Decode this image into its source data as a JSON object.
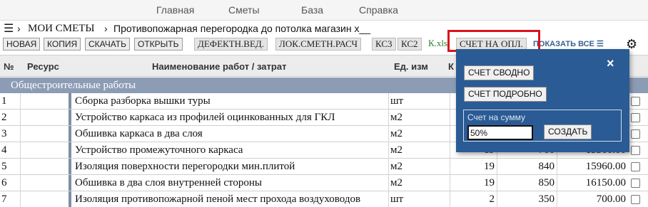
{
  "nav": {
    "items": [
      "Главная",
      "Сметы",
      "База",
      "Справка"
    ]
  },
  "breadcrumb": {
    "menu_icon": "hamburger-icon",
    "sep1": "›",
    "root": "МОИ СМЕТЫ",
    "sep2": "›",
    "title": "Противопожарная перегородка до потолка магазин х__"
  },
  "toolbar": {
    "new": "НОВАЯ",
    "copy": "КОПИЯ",
    "download": "СКАЧАТЬ",
    "open": "ОТКРЫТЬ",
    "defect": "ДЕФЕКТН.ВЕД.",
    "local": "ЛОК.СМЕТН.РАСЧ",
    "ks3": "КС3",
    "ks2": "КС2",
    "kxls": "К.xls",
    "invoice": "СЧЕТ НА ОПЛ.",
    "show_all": "ПОКАЗАТЬ ВСЕ ☰",
    "settings_icon": "gear-icon",
    "highlight_color": "#d9141c"
  },
  "table": {
    "headers": {
      "num": "№",
      "resource": "Ресурс",
      "name": "Наименование работ / затрат",
      "unit": "Ед. изм",
      "qty": "К"
    },
    "section": "Общестроительные работы",
    "rows": [
      {
        "num": "1",
        "name": "Сборка разборка вышки туры",
        "unit": "шт",
        "qty": "",
        "price": "",
        "sum": ""
      },
      {
        "num": "2",
        "name": "Устройство каркаса из профилей оцинкованных для ГКЛ",
        "unit": "м2",
        "qty": "",
        "price": "",
        "sum": ""
      },
      {
        "num": "3",
        "name": "Обшивка каркаса в два слоя",
        "unit": "м2",
        "qty": "",
        "price": "",
        "sum": ""
      },
      {
        "num": "4",
        "name": "Устройство промежуточного каркаса",
        "unit": "м2",
        "qty": "19",
        "price": "700",
        "sum": "13300.00"
      },
      {
        "num": "5",
        "name": "Изоляция поверхности перегородки мин.плитой",
        "unit": "м2",
        "qty": "19",
        "price": "840",
        "sum": "15960.00"
      },
      {
        "num": "6",
        "name": "Обшивка в два слоя внутренней стороны",
        "unit": "м2",
        "qty": "19",
        "price": "850",
        "sum": "16150.00"
      },
      {
        "num": "7",
        "name": "Изоляция противопожарной пеной мест прохода воздуховодов",
        "unit": "шт",
        "qty": "2",
        "price": "350",
        "sum": "700.00"
      }
    ]
  },
  "popup": {
    "close": "×",
    "summary": "СЧЕТ СВОДНО",
    "detailed": "СЧЕТ ПОДРОБНО",
    "amount_label": "Счет на сумму",
    "amount_value": "50%",
    "create": "СОЗДАТЬ",
    "background": "#2a5b94"
  }
}
